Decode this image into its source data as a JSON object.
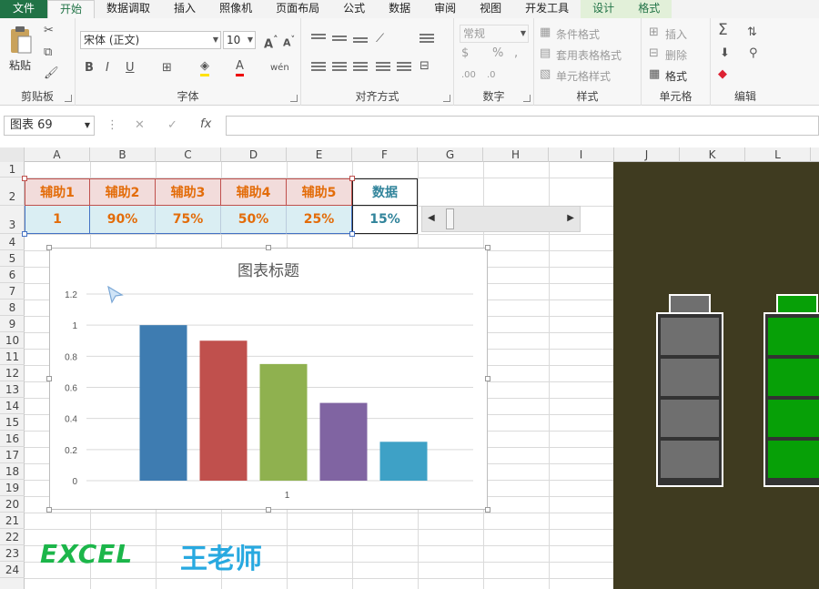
{
  "tabs": [
    "文件",
    "开始",
    "数据调取",
    "插入",
    "照像机",
    "页面布局",
    "公式",
    "数据",
    "审阅",
    "视图",
    "开发工具",
    "设计",
    "格式"
  ],
  "ribbon": {
    "clipboard": {
      "label": "剪贴板",
      "paste": "粘贴"
    },
    "font": {
      "label": "字体",
      "name": "宋体 (正文)",
      "size": "10"
    },
    "align": {
      "label": "对齐方式"
    },
    "number": {
      "label": "数字",
      "format": "常规"
    },
    "styles": {
      "label": "样式",
      "cond": "条件格式",
      "table": "套用表格格式",
      "cell": "单元格样式"
    },
    "cells": {
      "label": "单元格",
      "insert": "插入",
      "delete": "删除",
      "format": "格式"
    },
    "edit": {
      "label": "编辑"
    }
  },
  "formula_bar": {
    "name_box": "图表 69",
    "fx": "fx",
    "value": ""
  },
  "columns": [
    "A",
    "B",
    "C",
    "D",
    "E",
    "F",
    "G",
    "H",
    "I",
    "J",
    "K",
    "L"
  ],
  "rows": [
    "1",
    "2",
    "3",
    "4",
    "5",
    "6",
    "7",
    "8",
    "9",
    "10",
    "11",
    "12",
    "13",
    "14",
    "15",
    "16",
    "17",
    "18",
    "19",
    "20",
    "21",
    "22",
    "23",
    "24"
  ],
  "table": {
    "headers": [
      "辅助1",
      "辅助2",
      "辅助3",
      "辅助4",
      "辅助5"
    ],
    "values": [
      "1",
      "90%",
      "75%",
      "50%",
      "25%"
    ],
    "data_header": "数据",
    "data_value": "15%"
  },
  "chart_data": {
    "type": "bar",
    "title": "图表标题",
    "categories": [
      "1"
    ],
    "series": [
      {
        "values": [
          1.0
        ],
        "color": "#3e7cb1"
      },
      {
        "values": [
          0.9
        ],
        "color": "#c0504d"
      },
      {
        "values": [
          0.75
        ],
        "color": "#8fb14f"
      },
      {
        "values": [
          0.5
        ],
        "color": "#8064a2"
      },
      {
        "values": [
          0.25
        ],
        "color": "#3ea1c6"
      }
    ],
    "yticks": [
      "0",
      "0.2",
      "0.4",
      "0.6",
      "0.8",
      "1",
      "1.2"
    ],
    "ylim": [
      0,
      1.2
    ],
    "grid": true
  },
  "scrollbar": {
    "value_percent": 15
  },
  "batteries": [
    {
      "color": "#6f6f6f",
      "cells": 4
    },
    {
      "color": "#07a007",
      "cells": 4
    }
  ],
  "watermark": {
    "logo": "EXCEL",
    "author": "王老师"
  },
  "colors": {
    "accent": "#217346",
    "header_text": "#e36c09",
    "value_text": "#e36c09",
    "data_text": "#31849b"
  }
}
